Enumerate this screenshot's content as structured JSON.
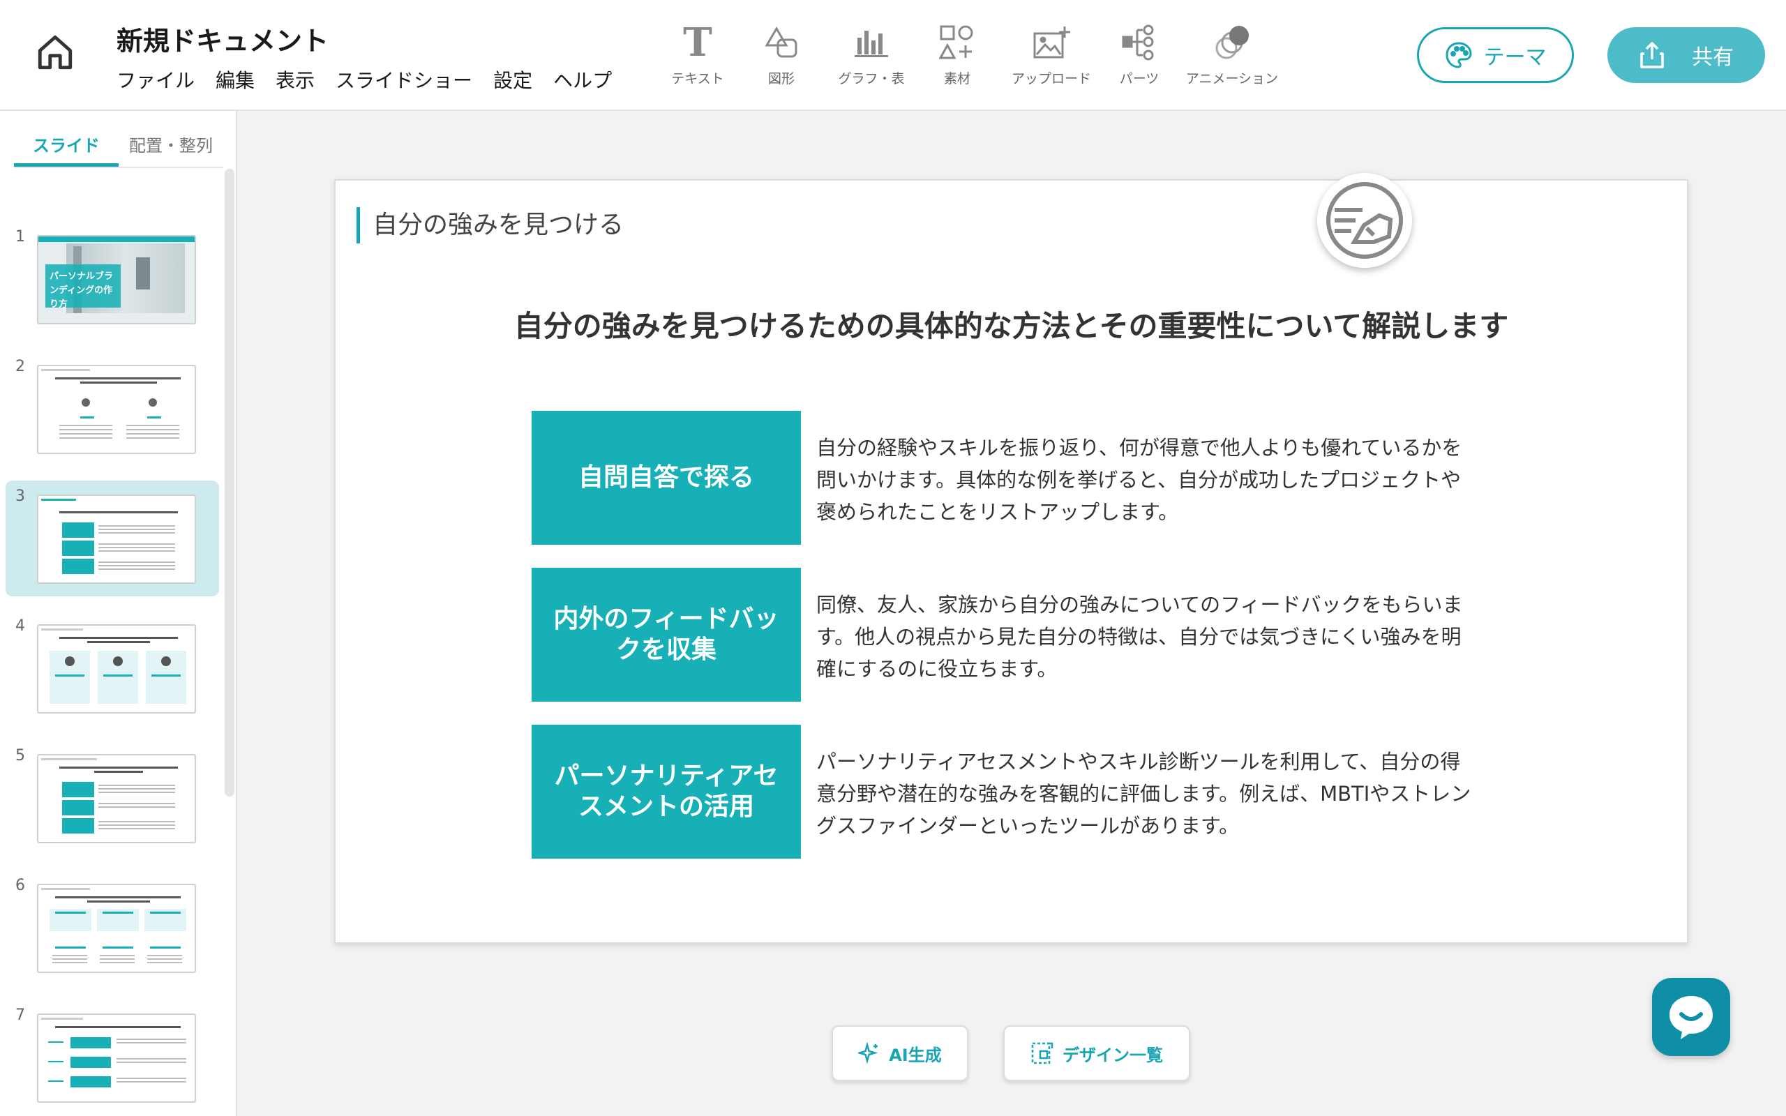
{
  "header": {
    "doc_title": "新規ドキュメント",
    "menu": [
      "ファイル",
      "編集",
      "表示",
      "スライドショー",
      "設定",
      "ヘルプ"
    ],
    "tools": [
      {
        "label": "テキスト",
        "icon": "text-icon"
      },
      {
        "label": "図形",
        "icon": "shape-icon"
      },
      {
        "label": "グラフ・表",
        "icon": "chart-icon"
      },
      {
        "label": "素材",
        "icon": "material-icon"
      },
      {
        "label": "アップロード",
        "icon": "upload-image-icon"
      },
      {
        "label": "パーツ",
        "icon": "parts-icon"
      },
      {
        "label": "アニメーション",
        "icon": "animation-icon"
      }
    ],
    "theme_label": "テーマ",
    "share_label": "共有"
  },
  "sidebar": {
    "tabs": [
      "スライド",
      "配置・整列"
    ],
    "active_tab": 0,
    "slide_numbers": [
      "1",
      "2",
      "3",
      "4",
      "5",
      "6",
      "7"
    ],
    "active_slide": 3,
    "thumb1_text": "パーソナルブランディングの作り方"
  },
  "slide": {
    "title": "自分の強みを見つける",
    "subtitle": "自分の強みを見つけるための具体的な方法とその重要性について解説します",
    "items": [
      {
        "heading": "自問自答で探る",
        "desc": "自分の経験やスキルを振り返り、何が得意で他人よりも優れているかを問いかけます。具体的な例を挙げると、自分が成功したプロジェクトや褒められたことをリストアップします。"
      },
      {
        "heading": "内外のフィードバックを収集",
        "desc": "同僚、友人、家族から自分の強みについてのフィードバックをもらいます。他人の視点から見た自分の特徴は、自分では気づきにくい強みを明確にするのに役立ちます。"
      },
      {
        "heading": "パーソナリティアセスメントの活用",
        "desc": "パーソナリティアセスメントやスキル診断ツールを利用して、自分の得意分野や潜在的な強みを客観的に評価します。例えば、MBTIやストレングスファインダーといったツールがあります。"
      }
    ]
  },
  "bottom": {
    "ai_label": "AI生成",
    "design_label": "デザイン一覧"
  },
  "colors": {
    "accent": "#17a4b4",
    "item_fill": "#17b0b6",
    "active_thumb_bg": "#cdeaef"
  }
}
